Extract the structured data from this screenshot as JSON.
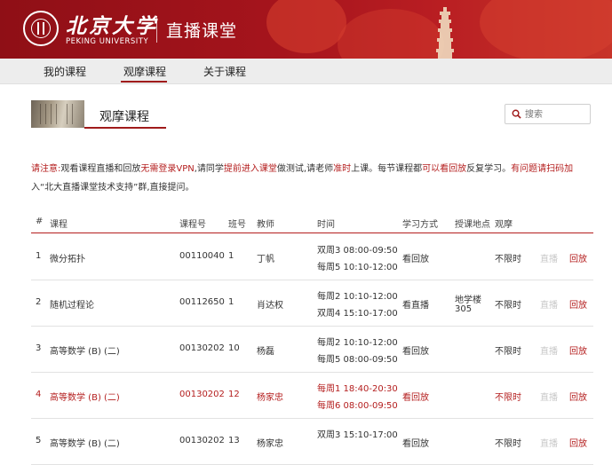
{
  "header": {
    "logo_cn": "北京大学",
    "logo_en": "PEKING UNIVERSITY",
    "site_title": "直播课堂"
  },
  "nav": [
    {
      "label": "我的课程",
      "active": false
    },
    {
      "label": "观摩课程",
      "active": true
    },
    {
      "label": "关于课程",
      "active": false
    }
  ],
  "section": {
    "title": "观摩课程"
  },
  "search": {
    "placeholder": "搜索",
    "icon": "search-icon"
  },
  "notice": {
    "prefix": "请注意:",
    "t1": "观看课程直播和回放",
    "r1": "无需登录VPN",
    "t2": ",请同学",
    "r2": "提前进入课堂",
    "t3": "做测试,请老师",
    "r3": "准时",
    "t4": "上课。每节课程都",
    "r4": "可以看回放",
    "t5": "反复学习。",
    "r5": "有问题请扫码加",
    "t6": "入“北大直播课堂技术支持”群,直接提问。"
  },
  "table": {
    "headers": [
      "#",
      "课程",
      "课程号",
      "班号",
      "教师",
      "时间",
      "学习方式",
      "授课地点",
      "观摩"
    ],
    "rows": [
      {
        "num": "1",
        "course": "微分拓扑",
        "code": "00110040",
        "class": "1",
        "teacher": "丁帆",
        "time1": "双周3  08:00-09:50",
        "time2": "每周5  10:10-12:00",
        "mode": "看回放",
        "location": "",
        "location2": "",
        "watch": "不限时",
        "live": "直播",
        "replay": "回放",
        "highlight": false
      },
      {
        "num": "2",
        "course": "随机过程论",
        "code": "00112650",
        "class": "1",
        "teacher": "肖达权",
        "time1": "每周2  10:10-12:00",
        "time2": "双周4  15:10-17:00",
        "mode": "看直播",
        "location": "地学楼",
        "location2": "305",
        "watch": "不限时",
        "live": "直播",
        "replay": "回放",
        "highlight": false
      },
      {
        "num": "3",
        "course": "高等数学 (B) (二)",
        "code": "00130202",
        "class": "10",
        "teacher": "杨磊",
        "time1": "每周2  10:10-12:00",
        "time2": "每周5  08:00-09:50",
        "mode": "看回放",
        "location": "",
        "location2": "",
        "watch": "不限时",
        "live": "直播",
        "replay": "回放",
        "highlight": false
      },
      {
        "num": "4",
        "course": "高等数学 (B) (二)",
        "code": "00130202",
        "class": "12",
        "teacher": "杨家忠",
        "time1": "每周1  18:40-20:30",
        "time2": "每周6  08:00-09:50",
        "mode": "看回放",
        "location": "",
        "location2": "",
        "watch": "不限时",
        "live": "直播",
        "replay": "回放",
        "highlight": true
      },
      {
        "num": "5",
        "course": "高等数学 (B) (二)",
        "code": "00130202",
        "class": "13",
        "teacher": "杨家忠",
        "time1": "双周3  15:10-17:00",
        "time2": "",
        "mode": "看回放",
        "location": "",
        "location2": "",
        "watch": "不限时",
        "live": "直播",
        "replay": "回放",
        "highlight": false
      }
    ]
  },
  "colors": {
    "brand_red": "#a01b1b",
    "nav_bg": "#ededed",
    "muted": "#c8c8c8"
  }
}
